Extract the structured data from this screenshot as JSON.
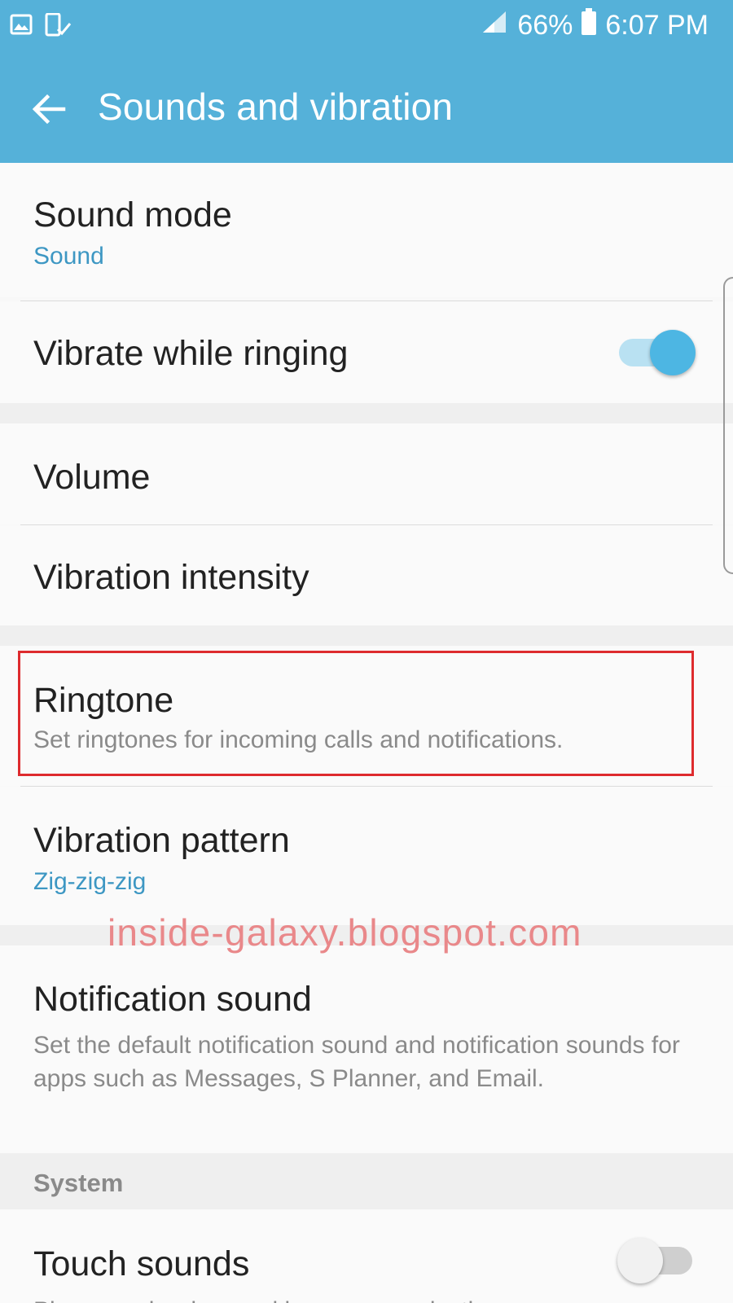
{
  "status_bar": {
    "battery_percent": "66%",
    "time": "6:07 PM",
    "icons": [
      "gallery-icon",
      "device-check-icon",
      "signal-icon",
      "battery-icon"
    ]
  },
  "app_bar": {
    "title": "Sounds and vibration",
    "back_icon": "back-arrow-icon"
  },
  "settings": {
    "sound_mode": {
      "label": "Sound mode",
      "value": "Sound"
    },
    "vibrate_while_ringing": {
      "label": "Vibrate while ringing",
      "enabled": true
    },
    "volume": {
      "label": "Volume"
    },
    "vibration_intensity": {
      "label": "Vibration intensity"
    },
    "ringtone": {
      "label": "Ringtone",
      "description": "Set ringtones for incoming calls and notifications."
    },
    "vibration_pattern": {
      "label": "Vibration pattern",
      "value": "Zig-zig-zig"
    },
    "notification_sound": {
      "label": "Notification sound",
      "description": "Set the default notification sound and notification sounds for apps such as Messages, S Planner, and Email."
    },
    "system_header": "System",
    "touch_sounds": {
      "label": "Touch sounds",
      "description": "Play sounds when making screen selection.",
      "enabled": false
    }
  },
  "watermark": "inside-galaxy.blogspot.com",
  "colors": {
    "accent": "#55b1d9",
    "link_blue": "#3d97c3",
    "highlight_red": "#de2b2e"
  }
}
